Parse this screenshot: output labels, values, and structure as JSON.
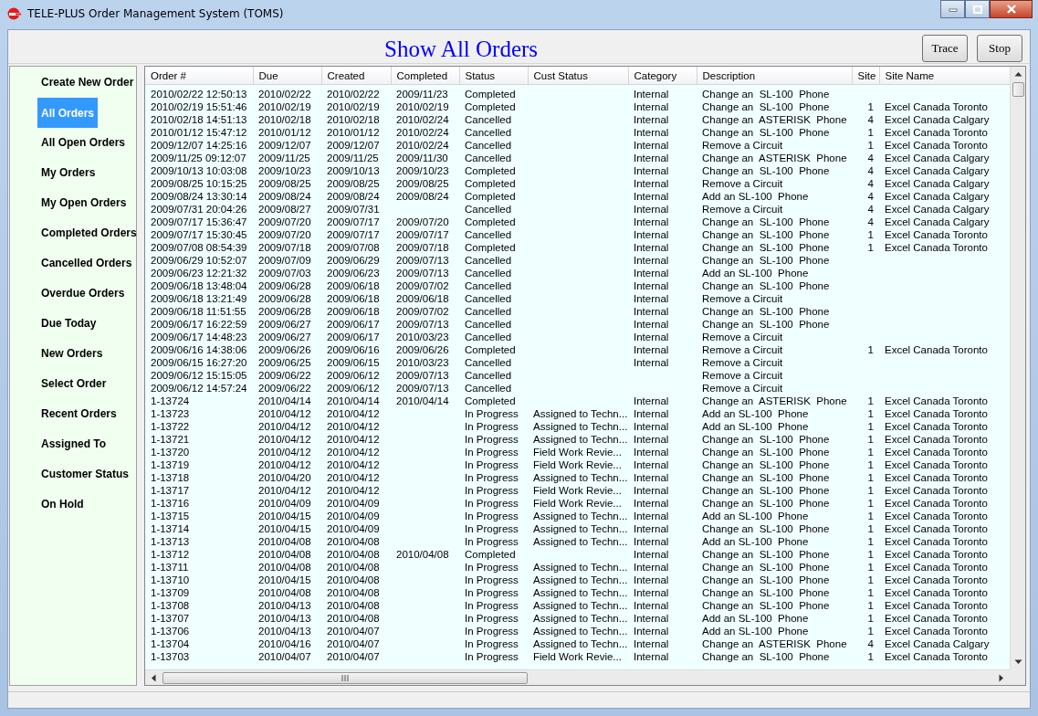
{
  "window": {
    "title": "TELE-PLUS Order Management System (TOMS)"
  },
  "header": {
    "title": "Show All Orders",
    "buttons": [
      "Trace",
      "Stop"
    ]
  },
  "sidebar": {
    "items": [
      {
        "label": "Create New Order",
        "selected": false
      },
      {
        "label": "All Orders",
        "selected": true
      },
      {
        "label": "All Open Orders",
        "selected": false
      },
      {
        "label": "My Orders",
        "selected": false
      },
      {
        "label": "My Open Orders",
        "selected": false
      },
      {
        "label": "Completed Orders",
        "selected": false
      },
      {
        "label": "Cancelled Orders",
        "selected": false
      },
      {
        "label": "Overdue Orders",
        "selected": false
      },
      {
        "label": "Due Today",
        "selected": false
      },
      {
        "label": "New Orders",
        "selected": false
      },
      {
        "label": "Select Order",
        "selected": false
      },
      {
        "label": "Recent Orders",
        "selected": false
      },
      {
        "label": "Assigned To",
        "selected": false
      },
      {
        "label": "Customer Status",
        "selected": false
      },
      {
        "label": "On Hold",
        "selected": false
      }
    ]
  },
  "table": {
    "columns": [
      "Order #",
      "Due",
      "Created",
      "Completed",
      "Status",
      "Cust Status",
      "Category",
      "Description",
      "Site",
      "Site Name"
    ],
    "rows": [
      {
        "order": "2010/02/22 12:50:13",
        "due": "2010/02/22",
        "created": "2010/02/22",
        "completed": "2009/11/23",
        "status": "Completed",
        "category": "Internal",
        "description": "Change an  SL-100  Phone"
      },
      {
        "order": "2010/02/19 15:51:46",
        "due": "2010/02/19",
        "created": "2010/02/19",
        "completed": "2010/02/19",
        "status": "Completed",
        "category": "Internal",
        "description": "Change an  SL-100  Phone",
        "site": "1",
        "site_name": "Excel Canada Toronto"
      },
      {
        "order": "2010/02/18 14:51:13",
        "due": "2010/02/18",
        "created": "2010/02/18",
        "completed": "2010/02/24",
        "status": "Cancelled",
        "category": "Internal",
        "description": "Change an  ASTERISK  Phone",
        "site": "4",
        "site_name": "Excel Canada Calgary"
      },
      {
        "order": "2010/01/12 15:47:12",
        "due": "2010/01/12",
        "created": "2010/01/12",
        "completed": "2010/02/24",
        "status": "Cancelled",
        "category": "Internal",
        "description": "Change an  SL-100  Phone",
        "site": "1",
        "site_name": "Excel Canada Toronto"
      },
      {
        "order": "2009/12/07 14:25:16",
        "due": "2009/12/07",
        "created": "2009/12/07",
        "completed": "2010/02/24",
        "status": "Cancelled",
        "category": "Internal",
        "description": "Remove a Circuit",
        "site": "1",
        "site_name": "Excel Canada Toronto"
      },
      {
        "order": "2009/11/25 09:12:07",
        "due": "2009/11/25",
        "created": "2009/11/25",
        "completed": "2009/11/30",
        "status": "Cancelled",
        "category": "Internal",
        "description": "Change an  ASTERISK  Phone",
        "site": "4",
        "site_name": "Excel Canada Calgary"
      },
      {
        "order": "2009/10/13 10:03:08",
        "due": "2009/10/23",
        "created": "2009/10/13",
        "completed": "2009/10/23",
        "status": "Completed",
        "category": "Internal",
        "description": "Change an  SL-100  Phone",
        "site": "4",
        "site_name": "Excel Canada Calgary"
      },
      {
        "order": "2009/08/25 10:15:25",
        "due": "2009/08/25",
        "created": "2009/08/25",
        "completed": "2009/08/25",
        "status": "Completed",
        "category": "Internal",
        "description": "Remove a Circuit",
        "site": "4",
        "site_name": "Excel Canada Calgary"
      },
      {
        "order": "2009/08/24 13:30:14",
        "due": "2009/08/24",
        "created": "2009/08/24",
        "completed": "2009/08/24",
        "status": "Completed",
        "category": "Internal",
        "description": "Add an SL-100  Phone",
        "site": "4",
        "site_name": "Excel Canada Calgary"
      },
      {
        "order": "2009/07/31 20:04:26",
        "due": "2009/08/27",
        "created": "2009/07/31",
        "status": "Cancelled",
        "category": "Internal",
        "description": "Remove a Circuit",
        "site": "4",
        "site_name": "Excel Canada Calgary"
      },
      {
        "order": "2009/07/17 15:36:47",
        "due": "2009/07/20",
        "created": "2009/07/17",
        "completed": "2009/07/20",
        "status": "Completed",
        "category": "Internal",
        "description": "Change an  SL-100  Phone",
        "site": "4",
        "site_name": "Excel Canada Calgary"
      },
      {
        "order": "2009/07/17 15:30:45",
        "due": "2009/07/20",
        "created": "2009/07/17",
        "completed": "2009/07/17",
        "status": "Cancelled",
        "category": "Internal",
        "description": "Change an  SL-100  Phone",
        "site": "1",
        "site_name": "Excel Canada Toronto"
      },
      {
        "order": "2009/07/08 08:54:39",
        "due": "2009/07/18",
        "created": "2009/07/08",
        "completed": "2009/07/18",
        "status": "Completed",
        "category": "Internal",
        "description": "Change an  SL-100  Phone",
        "site": "1",
        "site_name": "Excel Canada Toronto"
      },
      {
        "order": "2009/06/29 10:52:07",
        "due": "2009/07/09",
        "created": "2009/06/29",
        "completed": "2009/07/13",
        "status": "Cancelled",
        "category": "Internal",
        "description": "Change an  SL-100  Phone"
      },
      {
        "order": "2009/06/23 12:21:32",
        "due": "2009/07/03",
        "created": "2009/06/23",
        "completed": "2009/07/13",
        "status": "Cancelled",
        "category": "Internal",
        "description": "Add an SL-100  Phone"
      },
      {
        "order": "2009/06/18 13:48:04",
        "due": "2009/06/28",
        "created": "2009/06/18",
        "completed": "2009/07/02",
        "status": "Cancelled",
        "category": "Internal",
        "description": "Change an  SL-100  Phone"
      },
      {
        "order": "2009/06/18 13:21:49",
        "due": "2009/06/28",
        "created": "2009/06/18",
        "completed": "2009/06/18",
        "status": "Cancelled",
        "category": "Internal",
        "description": "Remove a Circuit"
      },
      {
        "order": "2009/06/18 11:51:55",
        "due": "2009/06/28",
        "created": "2009/06/18",
        "completed": "2009/07/02",
        "status": "Cancelled",
        "category": "Internal",
        "description": "Change an  SL-100  Phone"
      },
      {
        "order": "2009/06/17 16:22:59",
        "due": "2009/06/27",
        "created": "2009/06/17",
        "completed": "2009/07/13",
        "status": "Cancelled",
        "category": "Internal",
        "description": "Change an  SL-100  Phone"
      },
      {
        "order": "2009/06/17 14:48:23",
        "due": "2009/06/27",
        "created": "2009/06/17",
        "completed": "2010/03/23",
        "status": "Cancelled",
        "category": "Internal",
        "description": "Remove a Circuit"
      },
      {
        "order": "2009/06/16 14:38:06",
        "due": "2009/06/26",
        "created": "2009/06/16",
        "completed": "2009/06/26",
        "status": "Completed",
        "category": "Internal",
        "description": "Remove a Circuit",
        "site": "1",
        "site_name": "Excel Canada Toronto"
      },
      {
        "order": "2009/06/15 16:27:20",
        "due": "2009/06/25",
        "created": "2009/06/15",
        "completed": "2010/03/23",
        "status": "Cancelled",
        "category": "Internal",
        "description": "Remove a Circuit"
      },
      {
        "order": "2009/06/12 15:15:05",
        "due": "2009/06/22",
        "created": "2009/06/12",
        "completed": "2009/07/13",
        "status": "Cancelled",
        "description": "Remove a Circuit"
      },
      {
        "order": "2009/06/12 14:57:24",
        "due": "2009/06/22",
        "created": "2009/06/12",
        "completed": "2009/07/13",
        "status": "Cancelled",
        "description": "Remove a Circuit"
      },
      {
        "order": "1-13724",
        "due": "2010/04/14",
        "created": "2010/04/14",
        "completed": "2010/04/14",
        "status": "Completed",
        "category": "Internal",
        "description": "Change an  ASTERISK  Phone",
        "site": "1",
        "site_name": "Excel Canada Toronto"
      },
      {
        "order": "1-13723",
        "due": "2010/04/12",
        "created": "2010/04/12",
        "status": "In Progress",
        "cust_status": "Assigned to Techn...",
        "category": "Internal",
        "description": "Add an SL-100  Phone",
        "site": "1",
        "site_name": "Excel Canada Toronto"
      },
      {
        "order": "1-13722",
        "due": "2010/04/12",
        "created": "2010/04/12",
        "status": "In Progress",
        "cust_status": "Assigned to Techn...",
        "category": "Internal",
        "description": "Add an SL-100  Phone",
        "site": "1",
        "site_name": "Excel Canada Toronto"
      },
      {
        "order": "1-13721",
        "due": "2010/04/12",
        "created": "2010/04/12",
        "status": "In Progress",
        "cust_status": "Assigned to Techn...",
        "category": "Internal",
        "description": "Change an  SL-100  Phone",
        "site": "1",
        "site_name": "Excel Canada Toronto"
      },
      {
        "order": "1-13720",
        "due": "2010/04/12",
        "created": "2010/04/12",
        "status": "In Progress",
        "cust_status": "Field Work Revie...",
        "category": "Internal",
        "description": "Change an  SL-100  Phone",
        "site": "1",
        "site_name": "Excel Canada Toronto"
      },
      {
        "order": "1-13719",
        "due": "2010/04/12",
        "created": "2010/04/12",
        "status": "In Progress",
        "cust_status": "Field Work Revie...",
        "category": "Internal",
        "description": "Change an  SL-100  Phone",
        "site": "1",
        "site_name": "Excel Canada Toronto"
      },
      {
        "order": "1-13718",
        "due": "2010/04/20",
        "created": "2010/04/12",
        "status": "In Progress",
        "cust_status": "Assigned to Techn...",
        "category": "Internal",
        "description": "Change an  SL-100  Phone",
        "site": "1",
        "site_name": "Excel Canada Toronto"
      },
      {
        "order": "1-13717",
        "due": "2010/04/12",
        "created": "2010/04/12",
        "status": "In Progress",
        "cust_status": "Field Work Revie...",
        "category": "Internal",
        "description": "Change an  SL-100  Phone",
        "site": "1",
        "site_name": "Excel Canada Toronto"
      },
      {
        "order": "1-13716",
        "due": "2010/04/09",
        "created": "2010/04/09",
        "status": "In Progress",
        "cust_status": "Field Work Revie...",
        "category": "Internal",
        "description": "Change an  SL-100  Phone",
        "site": "1",
        "site_name": "Excel Canada Toronto"
      },
      {
        "order": "1-13715",
        "due": "2010/04/15",
        "created": "2010/04/09",
        "status": "In Progress",
        "cust_status": "Assigned to Techn...",
        "category": "Internal",
        "description": "Add an SL-100  Phone",
        "site": "1",
        "site_name": "Excel Canada Toronto"
      },
      {
        "order": "1-13714",
        "due": "2010/04/15",
        "created": "2010/04/09",
        "status": "In Progress",
        "cust_status": "Assigned to Techn...",
        "category": "Internal",
        "description": "Change an  SL-100  Phone",
        "site": "1",
        "site_name": "Excel Canada Toronto"
      },
      {
        "order": "1-13713",
        "due": "2010/04/08",
        "created": "2010/04/08",
        "status": "In Progress",
        "cust_status": "Assigned to Techn...",
        "category": "Internal",
        "description": "Add an SL-100  Phone",
        "site": "1",
        "site_name": "Excel Canada Toronto"
      },
      {
        "order": "1-13712",
        "due": "2010/04/08",
        "created": "2010/04/08",
        "completed": "2010/04/08",
        "status": "Completed",
        "category": "Internal",
        "description": "Change an  SL-100  Phone",
        "site": "1",
        "site_name": "Excel Canada Toronto"
      },
      {
        "order": "1-13711",
        "due": "2010/04/08",
        "created": "2010/04/08",
        "status": "In Progress",
        "cust_status": "Assigned to Techn...",
        "category": "Internal",
        "description": "Change an  SL-100  Phone",
        "site": "1",
        "site_name": "Excel Canada Toronto"
      },
      {
        "order": "1-13710",
        "due": "2010/04/15",
        "created": "2010/04/08",
        "status": "In Progress",
        "cust_status": "Assigned to Techn...",
        "category": "Internal",
        "description": "Change an  SL-100  Phone",
        "site": "1",
        "site_name": "Excel Canada Toronto"
      },
      {
        "order": "1-13709",
        "due": "2010/04/08",
        "created": "2010/04/08",
        "status": "In Progress",
        "cust_status": "Assigned to Techn...",
        "category": "Internal",
        "description": "Change an  SL-100  Phone",
        "site": "1",
        "site_name": "Excel Canada Toronto"
      },
      {
        "order": "1-13708",
        "due": "2010/04/13",
        "created": "2010/04/08",
        "status": "In Progress",
        "cust_status": "Assigned to Techn...",
        "category": "Internal",
        "description": "Change an  SL-100  Phone",
        "site": "1",
        "site_name": "Excel Canada Toronto"
      },
      {
        "order": "1-13707",
        "due": "2010/04/13",
        "created": "2010/04/08",
        "status": "In Progress",
        "cust_status": "Assigned to Techn...",
        "category": "Internal",
        "description": "Add an SL-100  Phone",
        "site": "1",
        "site_name": "Excel Canada Toronto"
      },
      {
        "order": "1-13706",
        "due": "2010/04/13",
        "created": "2010/04/07",
        "status": "In Progress",
        "cust_status": "Assigned to Techn...",
        "category": "Internal",
        "description": "Add an SL-100  Phone",
        "site": "1",
        "site_name": "Excel Canada Toronto"
      },
      {
        "order": "1-13704",
        "due": "2010/04/16",
        "created": "2010/04/07",
        "status": "In Progress",
        "cust_status": "Assigned to Techn...",
        "category": "Internal",
        "description": "Change an  ASTERISK  Phone",
        "site": "4",
        "site_name": "Excel Canada Calgary"
      },
      {
        "order": "1-13703",
        "due": "2010/04/07",
        "created": "2010/04/07",
        "status": "In Progress",
        "cust_status": "Field Work Revie...",
        "category": "Internal",
        "description": "Change an  SL-100  Phone",
        "site": "1",
        "site_name": "Excel Canada Toronto"
      }
    ]
  }
}
